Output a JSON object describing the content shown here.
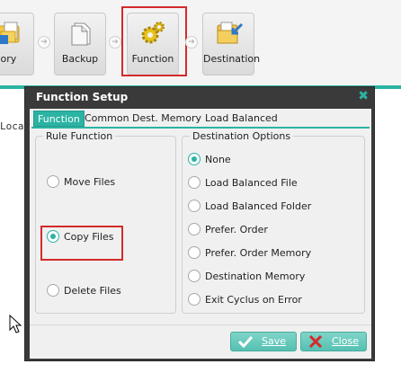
{
  "toolbar": {
    "steps": [
      {
        "label": "emory",
        "icon": "memory-folder-icon"
      },
      {
        "label": "Backup",
        "icon": "document-icon"
      },
      {
        "label": "Function",
        "icon": "gear-icon"
      },
      {
        "label": "Destination",
        "icon": "destination-folder-icon"
      }
    ]
  },
  "background": {
    "text": "Loca"
  },
  "dialog": {
    "title": "Function Setup",
    "close_glyph": "✖",
    "tabs": [
      "Function",
      "Common",
      "Dest. Memory",
      "Load Balanced"
    ],
    "active_tab": "Function",
    "rule_function": {
      "title": "Rule Function",
      "options": [
        "Move Files",
        "Copy Files",
        "Delete Files"
      ],
      "selected": "Copy Files"
    },
    "destination_options": {
      "title": "Destination Options",
      "options": [
        "None",
        "Load Balanced File",
        "Load Balanced Folder",
        "Prefer. Order",
        "Prefer. Order Memory",
        "Destination Memory",
        "Exit Cyclus on Error"
      ],
      "selected": "None"
    },
    "buttons": {
      "save": "Save",
      "close": "Close"
    }
  },
  "colors": {
    "accent": "#2bb3a3",
    "highlight": "#d42a2a",
    "title_bar": "#3a3a3a"
  }
}
